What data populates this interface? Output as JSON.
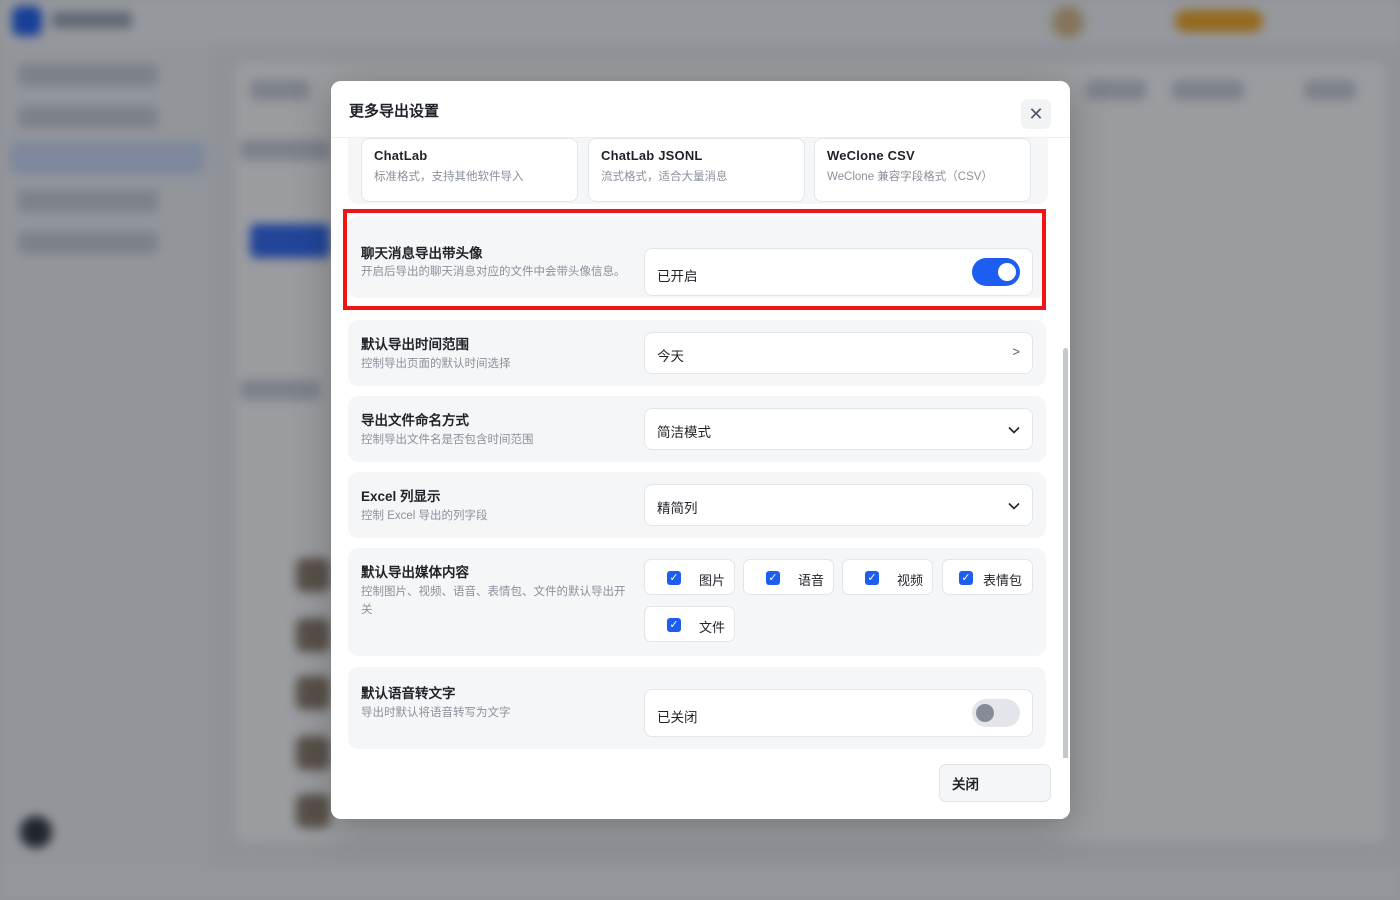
{
  "dialog": {
    "title": "更多导出设置",
    "close_icon": "close-icon",
    "formats": [
      {
        "name": "ChatLab",
        "desc": "标准格式，支持其他软件导入"
      },
      {
        "name": "ChatLab JSONL",
        "desc": "流式格式，适合大量消息"
      },
      {
        "name": "WeClone CSV",
        "desc": "WeClone 兼容字段格式（CSV）"
      }
    ],
    "avatar_export": {
      "title": "聊天消息导出带头像",
      "desc": "开启后导出的聊天消息对应的文件中会带头像信息。",
      "status": "已开启",
      "enabled": true
    },
    "time_range": {
      "title": "默认导出时间范围",
      "desc": "控制导出页面的默认时间选择",
      "value": "今天",
      "arrow": ">"
    },
    "file_naming": {
      "title": "导出文件命名方式",
      "desc": "控制导出文件名是否包含时间范围",
      "value": "简洁模式"
    },
    "excel_columns": {
      "title": "Excel 列显示",
      "desc": "控制 Excel 导出的列字段",
      "value": "精简列"
    },
    "media": {
      "title": "默认导出媒体内容",
      "desc": "控制图片、视频、语音、表情包、文件的默认导出开关",
      "options": [
        {
          "label": "图片",
          "checked": true
        },
        {
          "label": "语音",
          "checked": true
        },
        {
          "label": "视频",
          "checked": true
        },
        {
          "label": "表情包",
          "checked": true
        },
        {
          "label": "文件",
          "checked": true
        }
      ]
    },
    "voice_to_text": {
      "title": "默认语音转文字",
      "desc": "导出时默认将语音转写为文字",
      "status": "已关闭",
      "enabled": false
    },
    "close_button": "关闭"
  },
  "colors": {
    "accent": "#1d5ef0",
    "highlight": "#f01414"
  }
}
